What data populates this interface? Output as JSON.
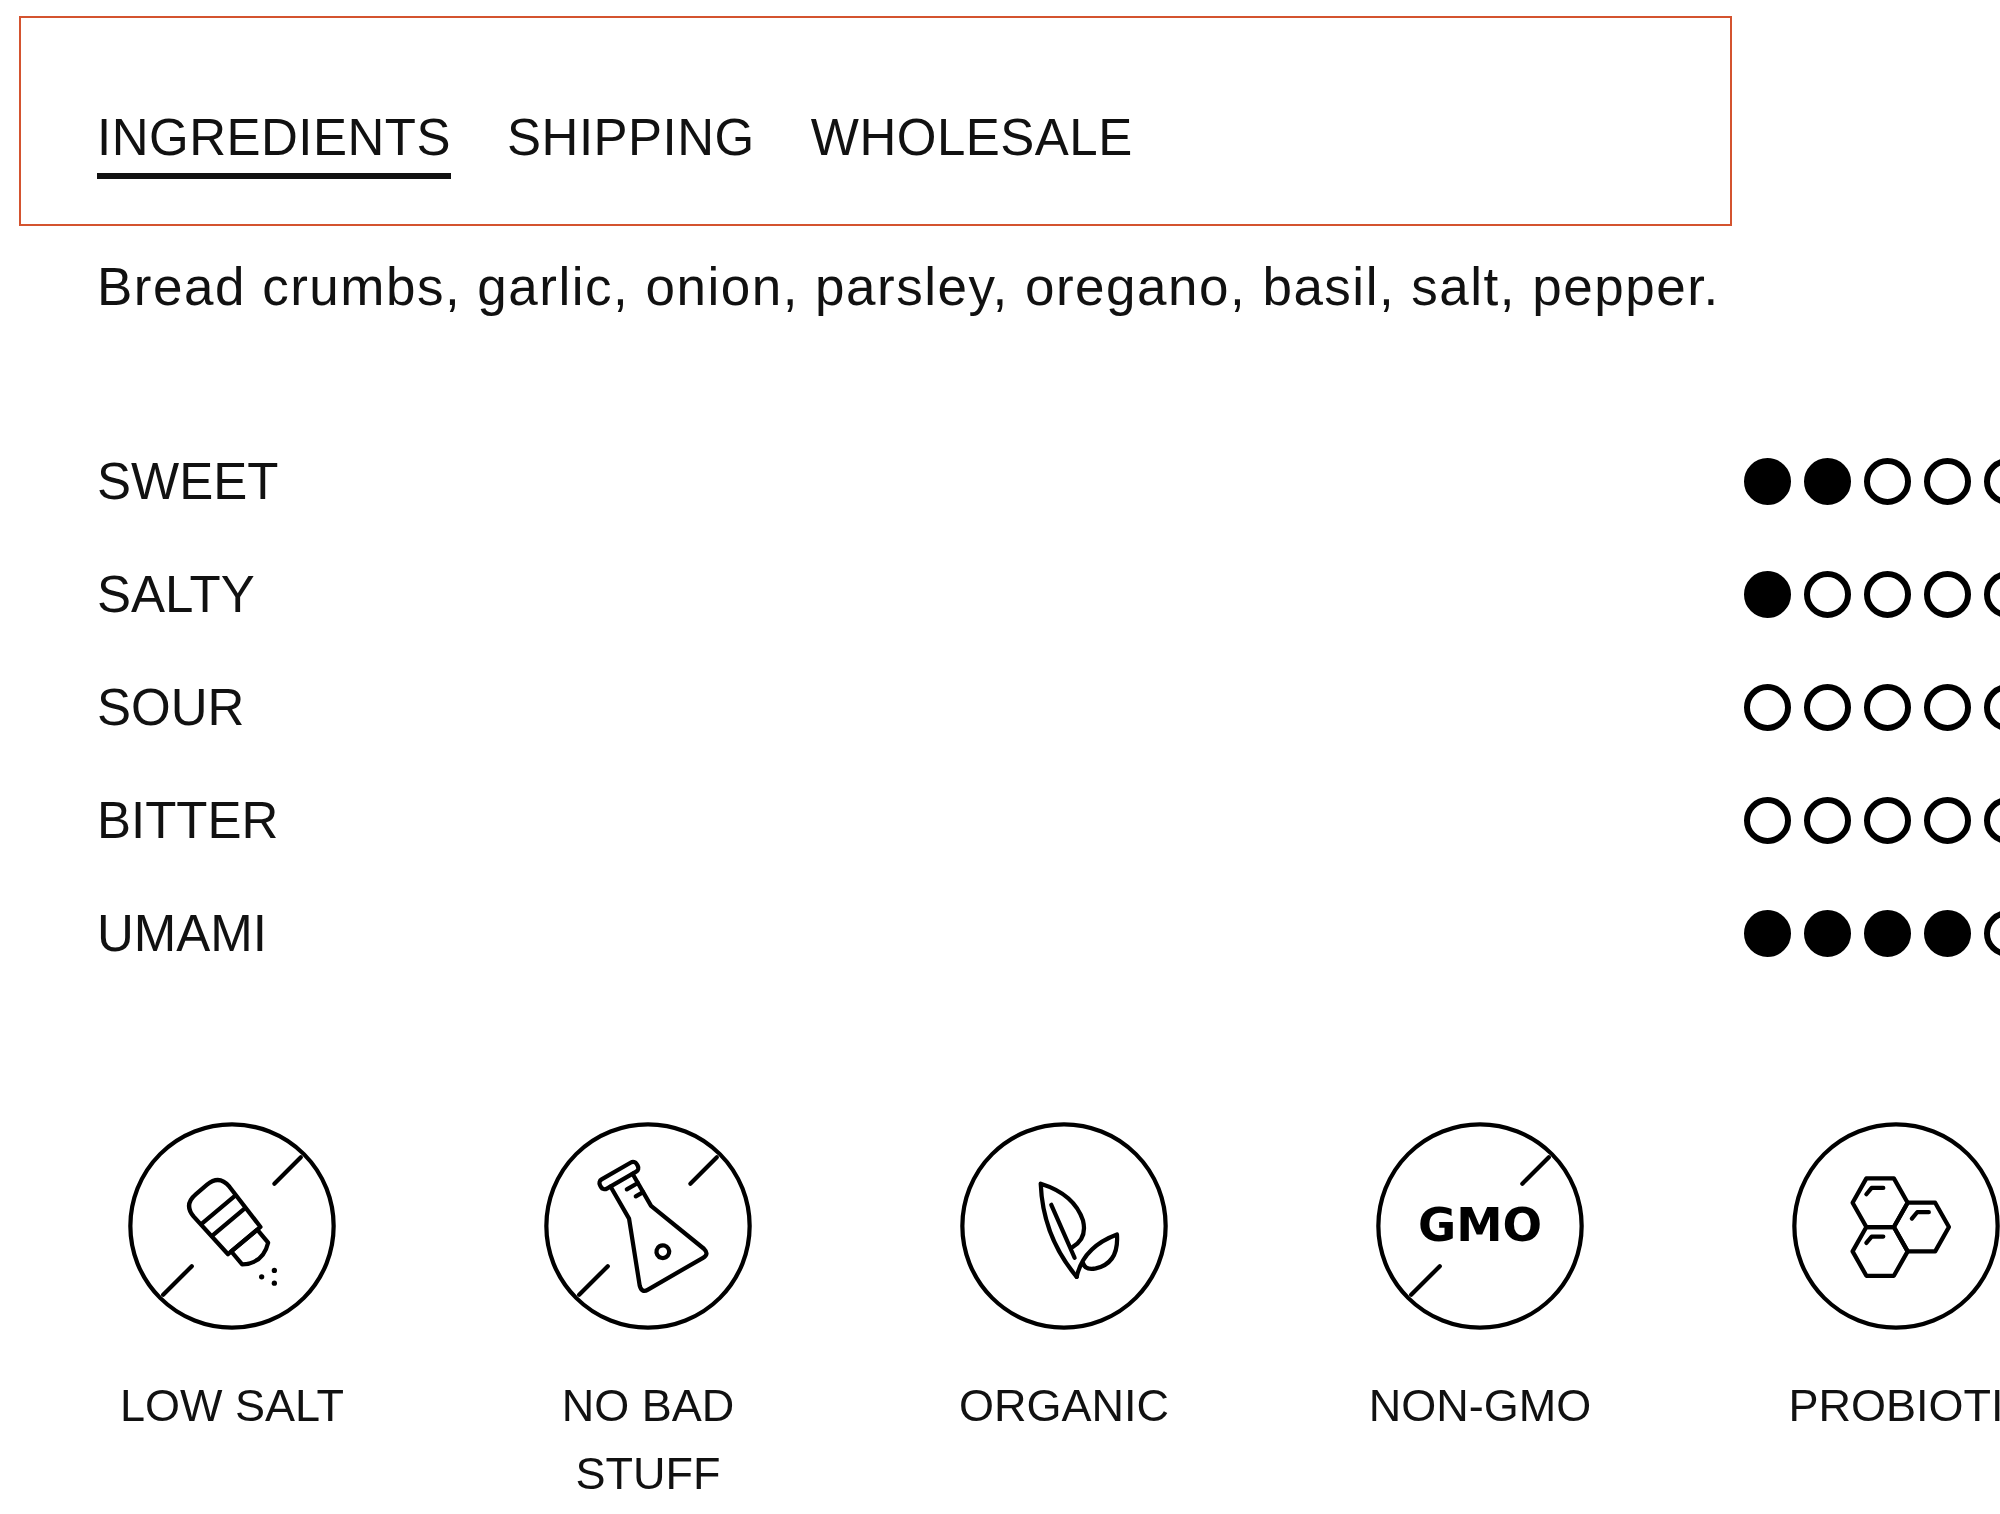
{
  "tabs": [
    {
      "label": "INGREDIENTS",
      "selected": true
    },
    {
      "label": "SHIPPING",
      "selected": false
    },
    {
      "label": "WHOLESALE",
      "selected": false
    }
  ],
  "ingredients": "Bread crumbs, garlic, onion, parsley, oregano, basil, salt, pepper.",
  "tastes": [
    {
      "label": "SWEET",
      "stars": 2
    },
    {
      "label": "SALTY",
      "stars": 1
    },
    {
      "label": "SOUR",
      "stars": 0
    },
    {
      "label": "BITTER",
      "stars": 0
    },
    {
      "label": "UMAMI",
      "stars": 4
    }
  ],
  "badges": [
    {
      "kind": "salt",
      "label": "LOW SALT"
    },
    {
      "kind": "flask",
      "label": "NO BAD STUFF"
    },
    {
      "kind": "leaf",
      "label": "ORGANIC"
    },
    {
      "kind": "gmo",
      "label": "NON-GMO",
      "icon_text": "GMO"
    },
    {
      "kind": "hexagon",
      "label": "PROBIOTI"
    }
  ]
}
